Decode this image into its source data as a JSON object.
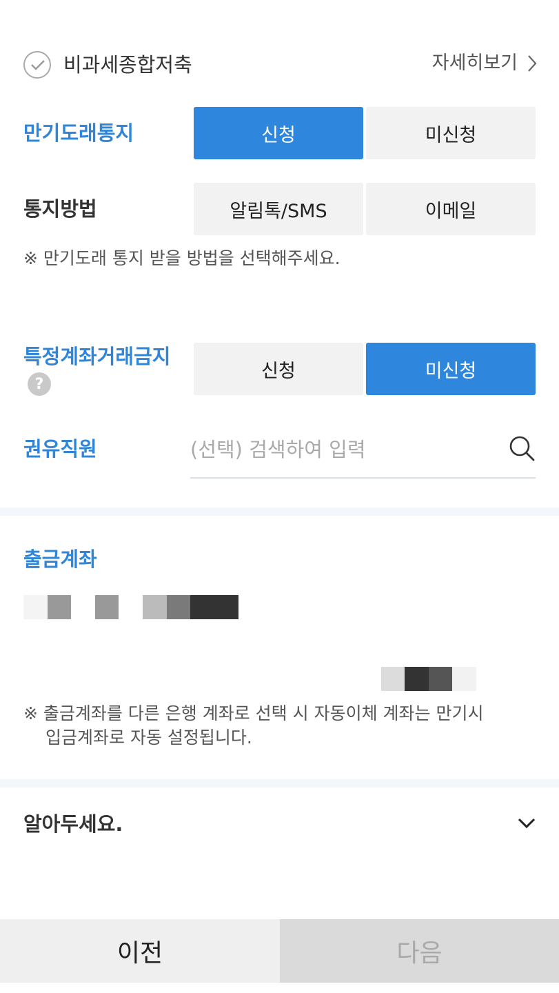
{
  "tax_free": {
    "label": "비과세종합저축",
    "detail_link": "자세히보기"
  },
  "maturity_notice": {
    "label": "만기도래통지",
    "options": [
      "신청",
      "미신청"
    ],
    "selected": "신청"
  },
  "notice_method": {
    "label": "통지방법",
    "options": [
      "알림톡/SMS",
      "이메일"
    ],
    "note": "※ 만기도래 통지 받을 방법을 선택해주세요."
  },
  "restricted_account": {
    "label": "특정계좌거래금지",
    "help_icon": "?",
    "options": [
      "신청",
      "미신청"
    ],
    "selected": "미신청"
  },
  "solicitor": {
    "label": "권유직원",
    "placeholder": "(선택) 검색하여 입력"
  },
  "withdraw_account": {
    "label": "출금계좌",
    "note_line1": "※ 출금계좌를 다른 은행 계좌로 선택 시 자동이체 계좌는 만기시",
    "note_line2": "입금계좌로 자동 설정됩니다."
  },
  "notice_section": {
    "label": "알아두세요."
  },
  "footer": {
    "prev": "이전",
    "next": "다음"
  },
  "colors": {
    "accent": "#2e86dd",
    "label_blue": "#2f86d8",
    "disabled_text": "#a9a9a9"
  }
}
